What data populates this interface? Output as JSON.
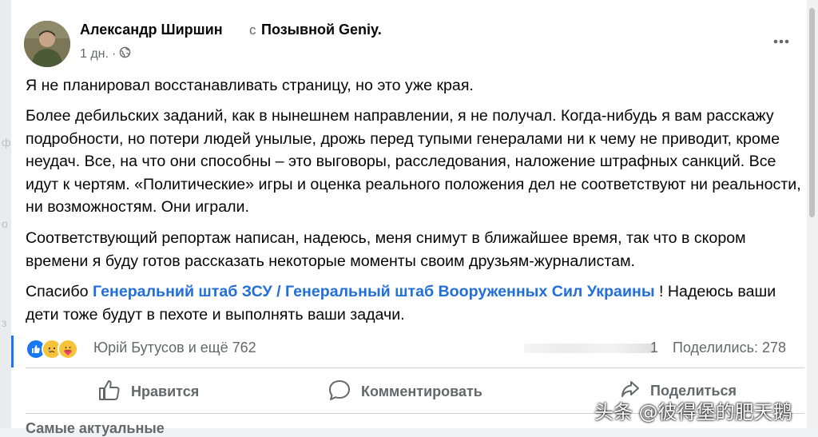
{
  "post": {
    "author": "Александр Ширшин",
    "group_sep": "с",
    "group": "Позывной Geniy.",
    "time": "1 дн.",
    "meta_sep": "·",
    "paragraphs": [
      "Я не планировал восстанавливать страницу, но это уже края.",
      "Более дебильских заданий, как в нынешнем направлении, я не получал. Когда-нибудь я вам расскажу подробности, но потери людей унылые, дрожь перед тупыми генералами ни к чему не приводит, кроме неудач. Все, на что они способны – это выговоры, расследования, наложение штрафных санкций. Все идут к чертям. «Политические» игры и оценка реального положения дел не соответствуют ни реальности, ни возможностям. Они играли.",
      "Соответствующий репортаж написан, надеюсь, меня снимут в ближайшее время, так что в скором времени я буду готов рассказать некоторые моменты своим друзьям-журналистам."
    ],
    "thanks_prefix": "Спасибо ",
    "thanks_link": "Генеральний штаб ЗСУ / Генеральный штаб Вооруженных Сил Украины",
    "thanks_suffix": " ! Надеюсь ваши дети тоже будут в пехоте и выполнять ваши задачи."
  },
  "reactions": {
    "types": [
      "like-icon",
      "sad-icon",
      "care-icon"
    ],
    "summary": "Юрій Бутусов и ещё 762",
    "partial_count": "1",
    "shares": "Поделились: 278"
  },
  "actions": {
    "like": "Нравится",
    "comment": "Комментировать",
    "share": "Поделиться"
  },
  "comments_filter": "Самые актуальные",
  "watermark": "头条 @彼得堡的肥天鹅",
  "colors": {
    "link": "#216fdb",
    "like_blue": "#1877f2",
    "muted_text": "#65676b"
  }
}
